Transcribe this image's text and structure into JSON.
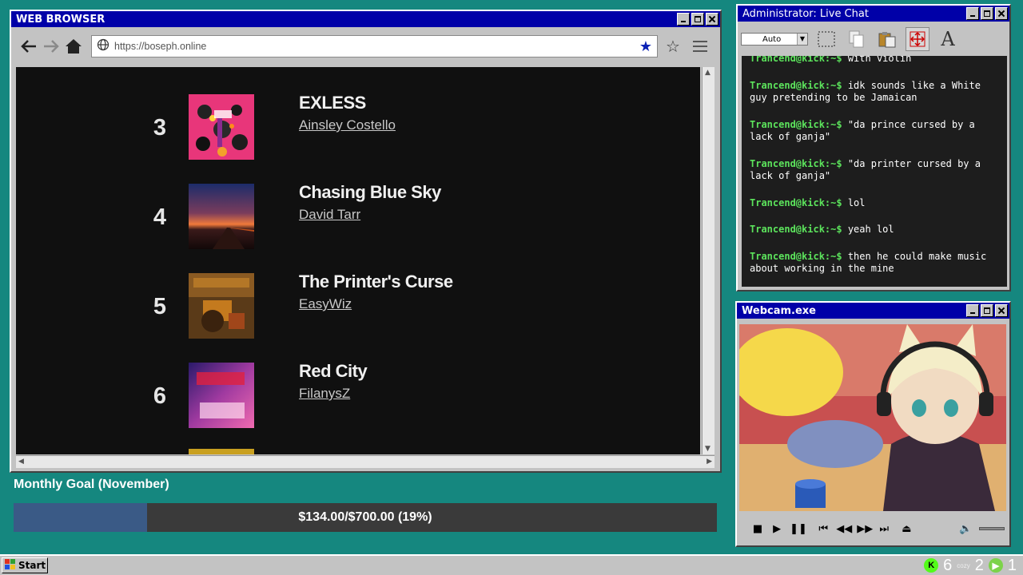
{
  "browser": {
    "title": "WEB BROWSER",
    "url": "https://boseph.online",
    "icons": [
      "back-arrow-icon",
      "forward-arrow-icon",
      "home-icon",
      "globe-icon",
      "bookmark-star-filled-icon",
      "bookmark-star-outline-icon",
      "menu-hamburger-icon"
    ]
  },
  "chart_list": [
    {
      "rank": "3",
      "title": "EXLESS",
      "artist": "Ainsley Costello"
    },
    {
      "rank": "4",
      "title": "Chasing Blue Sky",
      "artist": "David Tarr"
    },
    {
      "rank": "5",
      "title": "The Printer's Curse",
      "artist": "EasyWiz"
    },
    {
      "rank": "6",
      "title": "Red City",
      "artist": "FilanysZ"
    }
  ],
  "goal": {
    "label": "Monthly Goal (November)",
    "amount_text": "$134.00/$700.00 (19%)",
    "progress_fraction": 0.19,
    "fill_color": "#3a5a86"
  },
  "chat": {
    "title": "Administrator: Live Chat",
    "font_select": "Auto",
    "messages": [
      {
        "user": "Trancend@kick:~$",
        "text": " with violin"
      },
      {
        "user": "Trancend@kick:~$",
        "text": " idk sounds like a White guy pretending to be Jamaican"
      },
      {
        "user": "Trancend@kick:~$",
        "text": " \"da prince cursed by a lack of ganja\""
      },
      {
        "user": "Trancend@kick:~$",
        "text": " \"da printer cursed by a lack of ganja\""
      },
      {
        "user": "Trancend@kick:~$",
        "text": " lol"
      },
      {
        "user": "Trancend@kick:~$",
        "text": " yeah lol"
      },
      {
        "user": "Trancend@kick:~$",
        "text": " then he could make music about working in the mine"
      }
    ],
    "user_color": "#5ce35c"
  },
  "webcam": {
    "title": "Webcam.exe"
  },
  "taskbar": {
    "start_label": "Start",
    "tray_kick_count": "6",
    "tray_cozy_label": "cozy",
    "tray_cozy_count": "2",
    "tray_play_count": "1"
  }
}
